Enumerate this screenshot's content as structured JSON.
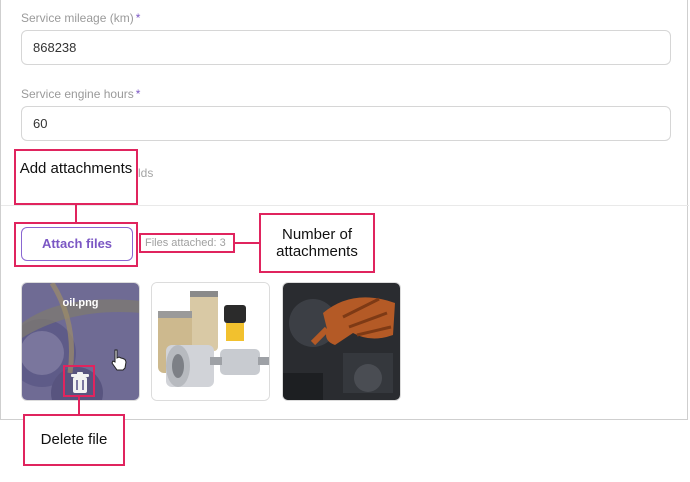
{
  "form": {
    "mileage_label": "Service mileage (km)",
    "mileage_required": "*",
    "mileage_value": "868238",
    "engine_hours_label": "Service engine hours",
    "engine_hours_required": "*",
    "engine_hours_value": "60",
    "extra_fields_fragment": "lds"
  },
  "attachments": {
    "attach_button_label": "Attach files",
    "files_attached_text": "Files attached: 3",
    "files": [
      {
        "name": "oil.png",
        "icon": "oil-image"
      },
      {
        "name": "",
        "icon": "filters-image"
      },
      {
        "name": "",
        "icon": "engine-repair-image"
      }
    ],
    "delete_icon": "trash-icon",
    "cursor_icon": "hand-pointer-icon"
  },
  "callouts": {
    "add_attachments": "Add attachments",
    "number_of_attachments": "Number of attachments",
    "delete_file": "Delete file"
  },
  "colors": {
    "accent": "#7b57c4",
    "callout": "#e0245e"
  }
}
